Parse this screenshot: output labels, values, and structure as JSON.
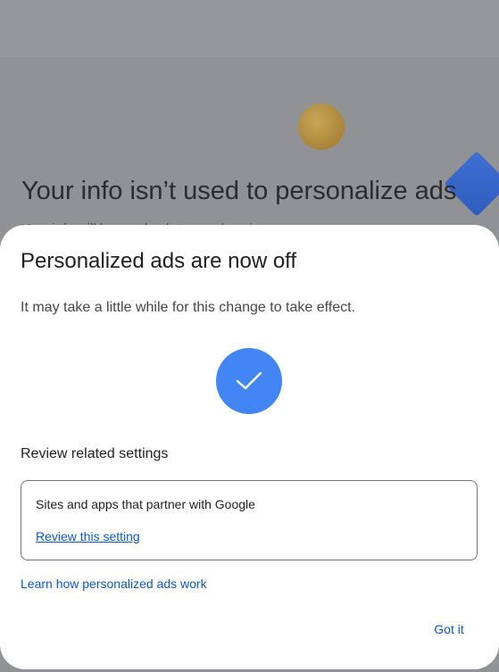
{
  "background": {
    "heading": "Your info isn’t used to personalize ads",
    "subtext": "Your info will be used only to ... ads ... in ...",
    "topbar_color": "#95979a",
    "overlay_color": "#909296"
  },
  "dialog": {
    "title": "Personalized ads are now off",
    "description": "It may take a little while for this change to take effect.",
    "status_icon": "check-icon",
    "accent_color": "#4285f4",
    "related": {
      "heading": "Review related settings",
      "card": {
        "title": "Sites and apps that partner with Google",
        "link": "Review this setting"
      }
    },
    "learn_link": "Learn how personalized ads work",
    "confirm_button": "Got it",
    "link_color": "#0b57d0"
  }
}
